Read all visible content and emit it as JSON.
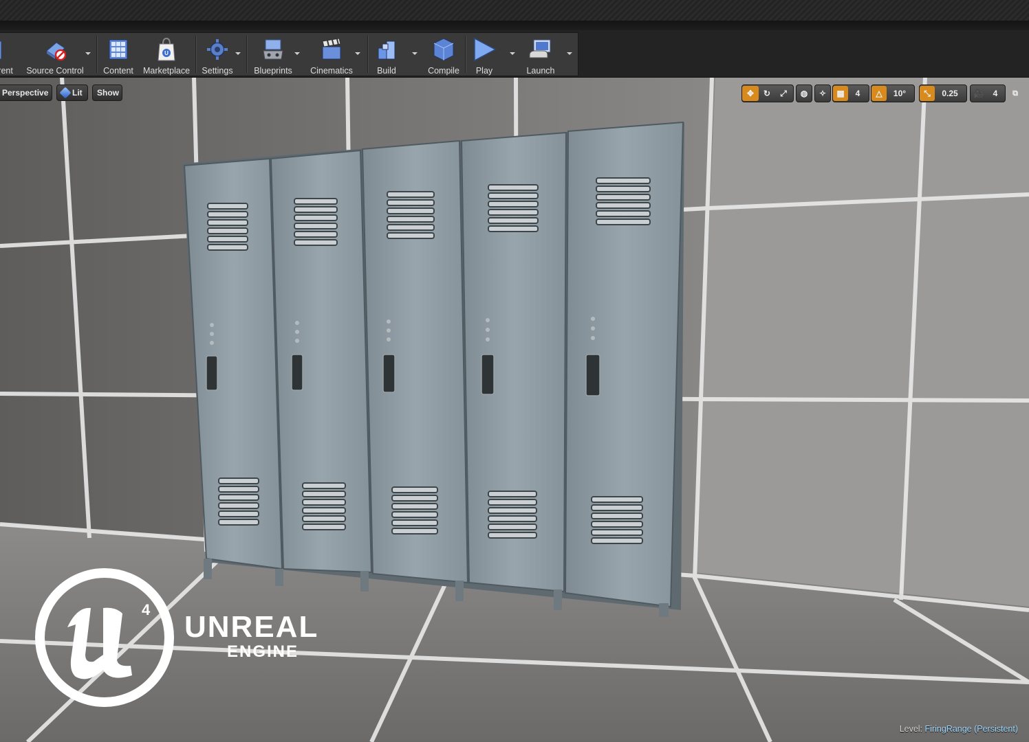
{
  "toolbar": {
    "buttons": [
      {
        "label": "rrent",
        "icon": "current-level-icon"
      },
      {
        "label": "Source Control",
        "icon": "source-control-icon"
      },
      {
        "label": "Content",
        "icon": "content-browser-icon"
      },
      {
        "label": "Marketplace",
        "icon": "marketplace-icon"
      },
      {
        "label": "Settings",
        "icon": "settings-icon"
      },
      {
        "label": "Blueprints",
        "icon": "blueprints-icon"
      },
      {
        "label": "Cinematics",
        "icon": "cinematics-icon"
      },
      {
        "label": "Build",
        "icon": "build-icon"
      },
      {
        "label": "Compile",
        "icon": "compile-icon"
      },
      {
        "label": "Play",
        "icon": "play-icon"
      },
      {
        "label": "Launch",
        "icon": "launch-icon"
      }
    ]
  },
  "viewport": {
    "perspective_label": "Perspective",
    "lit_label": "Lit",
    "show_label": "Show",
    "grid_snap_value": "4",
    "rotation_snap_value": "10°",
    "scale_snap_value": "0.25",
    "camera_speed_value": "4",
    "level_label": "Level:",
    "level_name": "FiringRange (Persistent)"
  },
  "watermark": {
    "line1": "UNREAL",
    "line2": "ENGINE",
    "badge_number": "4"
  },
  "colors": {
    "accent_orange": "#d88a1c",
    "level_name_color": "#9fd9ff",
    "locker_paint": "#8c9aa3"
  }
}
